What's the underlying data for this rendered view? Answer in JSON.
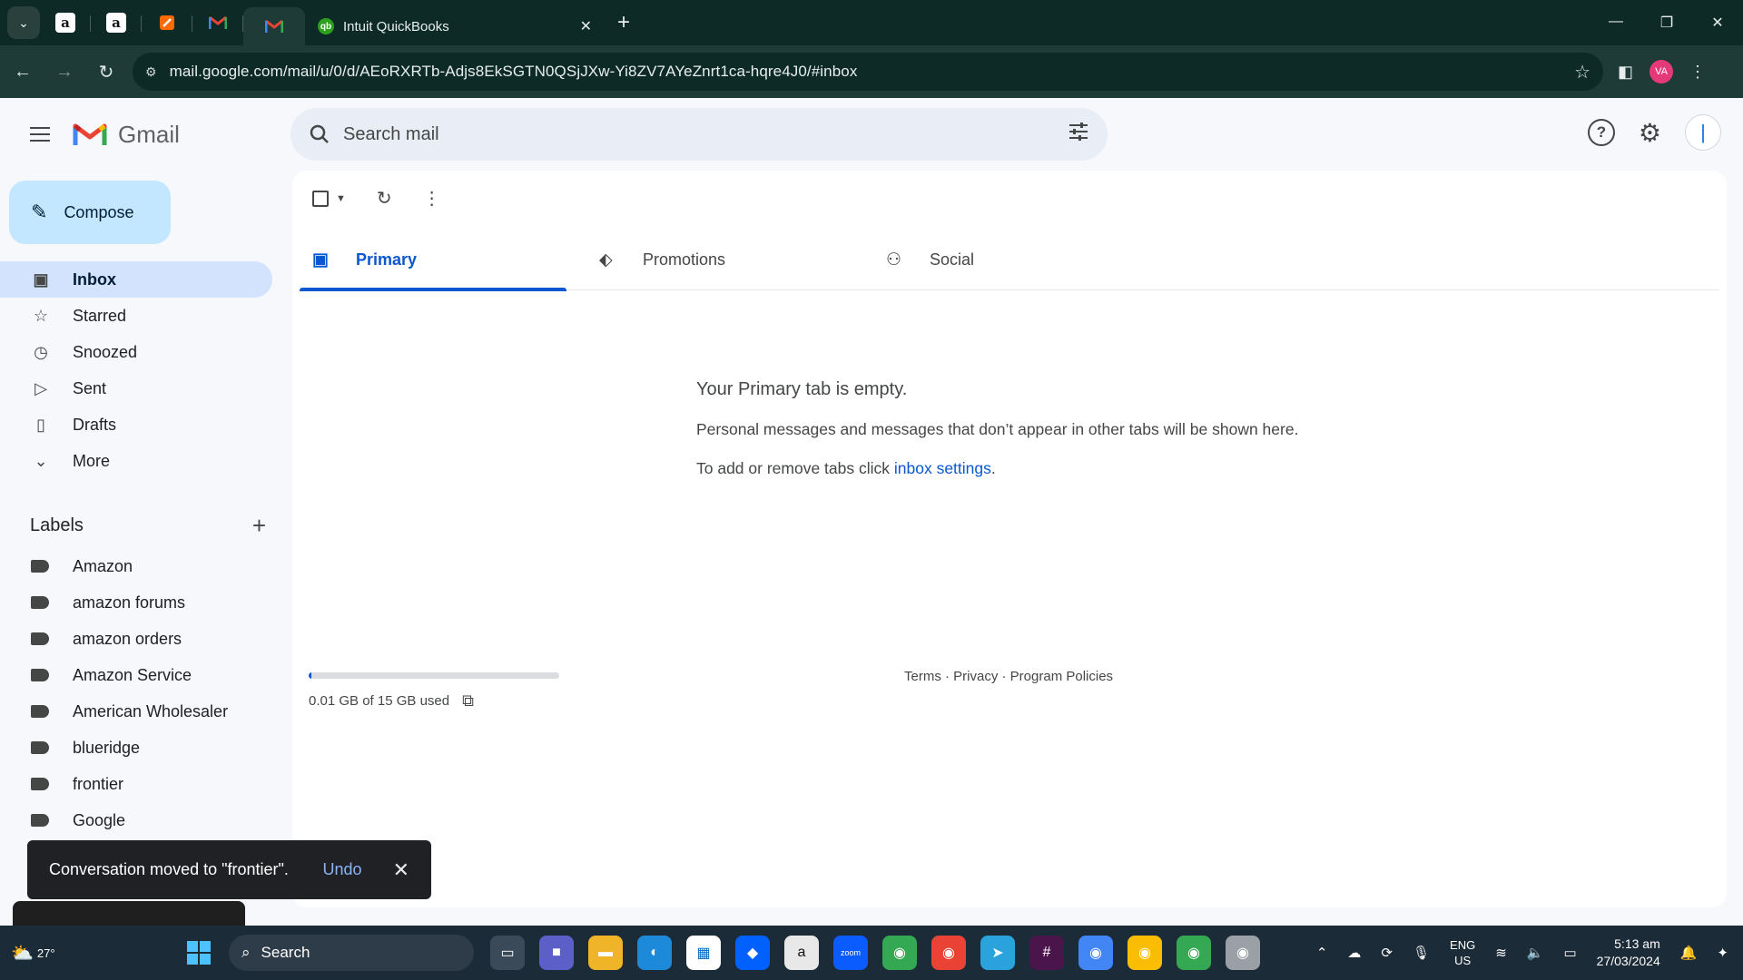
{
  "browser": {
    "tabs": [
      {
        "favicon": "amazon-icon"
      },
      {
        "favicon": "amazon-icon"
      },
      {
        "favicon": "zapier-icon"
      },
      {
        "favicon": "gmail-icon"
      },
      {
        "favicon": "gmail-icon",
        "active": true
      },
      {
        "favicon": "quickbooks-icon",
        "title": "Intuit QuickBooks"
      }
    ],
    "url": "mail.google.com/mail/u/0/d/AEoRXRTb-Adjs8EkSGTN0QSjJXw-Yi8ZV7AYeZnrt1ca-hqre4J0/#inbox",
    "profile_initials": "VA"
  },
  "gmail": {
    "logo_text": "Gmail",
    "search_placeholder": "Search mail",
    "compose_label": "Compose",
    "nav": [
      {
        "label": "Inbox",
        "icon": "inbox-icon",
        "active": true
      },
      {
        "label": "Starred",
        "icon": "star-icon"
      },
      {
        "label": "Snoozed",
        "icon": "clock-icon"
      },
      {
        "label": "Sent",
        "icon": "send-icon"
      },
      {
        "label": "Drafts",
        "icon": "draft-icon"
      },
      {
        "label": "More",
        "icon": "chevron-down-icon"
      }
    ],
    "labels_heading": "Labels",
    "labels": [
      "Amazon",
      "amazon forums",
      "amazon orders",
      "Amazon Service",
      "American Wholesaler",
      "blueridge",
      "frontier",
      "Google"
    ],
    "category_tabs": [
      {
        "label": "Primary",
        "icon": "inbox-icon",
        "active": true
      },
      {
        "label": "Promotions",
        "icon": "tag-icon"
      },
      {
        "label": "Social",
        "icon": "people-icon"
      }
    ],
    "empty_title": "Your Primary tab is empty.",
    "empty_text": "Personal messages and messages that don’t appear in other tabs will be shown here.",
    "empty_settings_prefix": "To add or remove tabs click ",
    "empty_settings_link": "inbox settings",
    "empty_settings_suffix": ".",
    "storage_used": "0.01 GB of 15 GB used",
    "storage_fraction": 0.01,
    "footer": "Terms · Privacy · Program Policies",
    "snackbar": {
      "message": "Conversation moved to \"frontier\".",
      "undo": "Undo"
    }
  },
  "taskbar": {
    "temperature": "27°",
    "search_label": "Search",
    "lang_line1": "ENG",
    "lang_line2": "US",
    "time": "5:13 am",
    "date": "27/03/2024"
  },
  "colors": {
    "accent": "#0b57d0",
    "compose_bg": "#c2e7ff",
    "active_nav_bg": "#d3e3fd"
  }
}
